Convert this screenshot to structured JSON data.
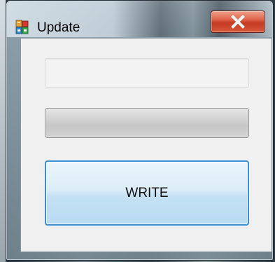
{
  "window": {
    "title": "Update",
    "app_icon": "colored-blocks-app-icon",
    "close_icon": "close-x-icon",
    "close_color": "#c43a22"
  },
  "form": {
    "text_field_value": "",
    "progress": 0,
    "write_button_label": "WRITE",
    "write_button_border_color": "#3c8fd0"
  }
}
